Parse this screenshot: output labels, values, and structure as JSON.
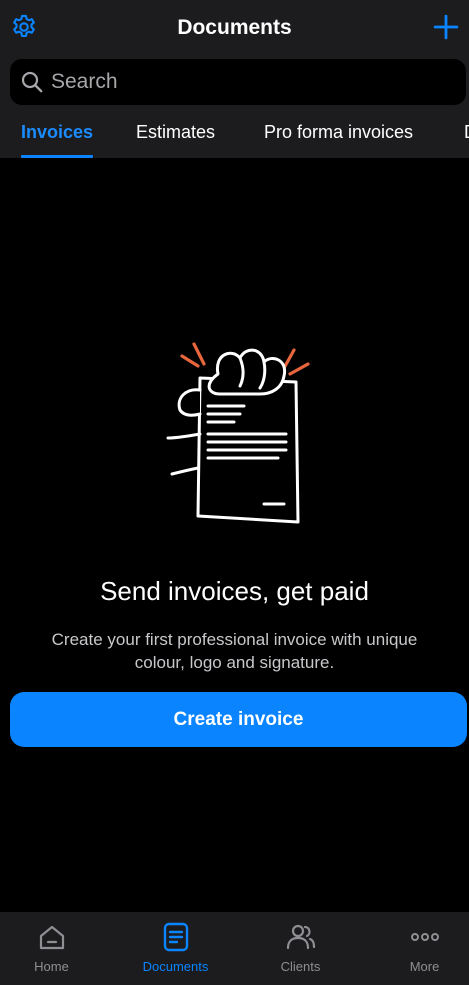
{
  "header": {
    "title": "Documents",
    "settings_icon": "gear-icon",
    "add_icon": "plus-icon"
  },
  "search": {
    "placeholder": "Search"
  },
  "tabs": [
    {
      "label": "Invoices",
      "active": true
    },
    {
      "label": "Estimates",
      "active": false
    },
    {
      "label": "Pro forma invoices",
      "active": false
    },
    {
      "label": "D",
      "active": false
    }
  ],
  "empty_state": {
    "illustration": "hand-holding-document-illustration",
    "title": "Send invoices, get paid",
    "description": "Create your first professional invoice with unique colour, logo and signature.",
    "button_label": "Create invoice"
  },
  "tabbar": {
    "items": [
      {
        "label": "Home",
        "icon": "home-icon",
        "active": false
      },
      {
        "label": "Documents",
        "icon": "documents-icon",
        "active": true
      },
      {
        "label": "Clients",
        "icon": "clients-icon",
        "active": false
      },
      {
        "label": "More",
        "icon": "more-icon",
        "active": false
      }
    ]
  },
  "colors": {
    "accent": "#0a84ff",
    "background": "#000000",
    "surface": "#1c1c1e",
    "illustration_accent": "#e8663d"
  }
}
